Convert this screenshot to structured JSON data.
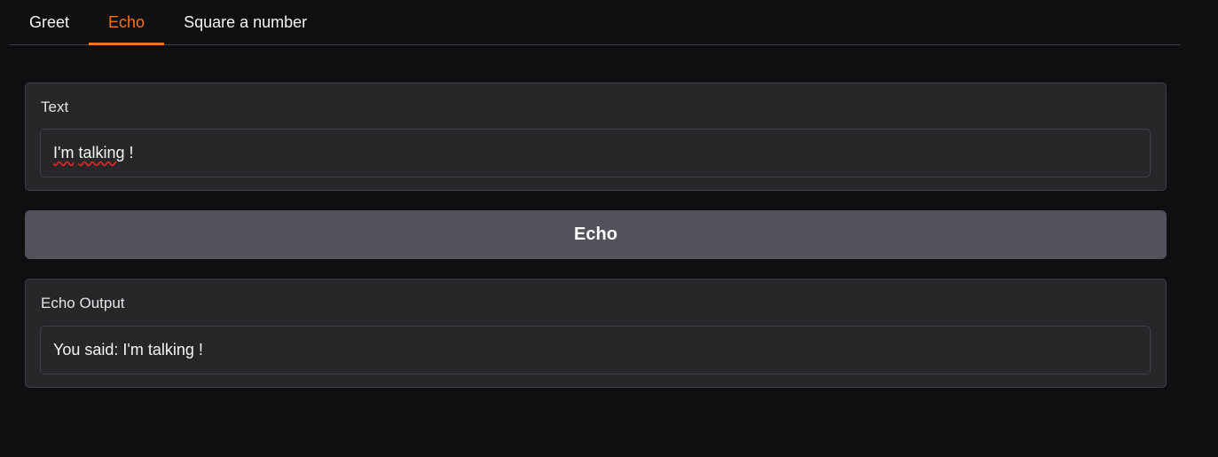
{
  "tabs": [
    {
      "label": "Greet",
      "active": false
    },
    {
      "label": "Echo",
      "active": true
    },
    {
      "label": "Square a number",
      "active": false
    }
  ],
  "input_panel": {
    "label": "Text",
    "value_word1": "I'm",
    "value_word2": "talking",
    "value_rest": " !"
  },
  "button": {
    "label": "Echo"
  },
  "output_panel": {
    "label": "Echo Output",
    "value": "You said: I'm talking !"
  },
  "colors": {
    "accent": "#f97316",
    "background": "#0f0f11",
    "panel": "#27272a",
    "button": "#52525b"
  }
}
